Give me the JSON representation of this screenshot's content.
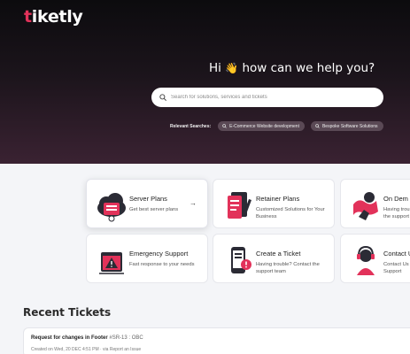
{
  "brand": {
    "logo_text_accent": "t",
    "logo_text_rest": "iketly",
    "accent_color": "#e2325a"
  },
  "hero": {
    "greeting_before": "Hi",
    "greeting_emoji": "👋",
    "greeting_after": "how can we help you?",
    "search_placeholder": "Search for solutions, services and tickets",
    "relevant_label": "Relevant Searches:",
    "relevant_chips": [
      "E-Commerce Website development",
      "Bespoke Software Solutions"
    ]
  },
  "services": [
    {
      "title": "Server Plans",
      "description": "Get best server plans",
      "icon": "server-cloud-icon",
      "active": true
    },
    {
      "title": "Retainer Plans",
      "description": "Customized Solutions for Your Business",
      "icon": "document-plan-icon"
    },
    {
      "title": "On Dem",
      "description": "Having troub the support",
      "icon": "on-demand-icon"
    },
    {
      "title": "Emergency Support",
      "description": "Fast response to your needs",
      "icon": "warning-window-icon"
    },
    {
      "title": "Create a Ticket",
      "description": "Having trouble? Contact the support team",
      "icon": "ticket-phone-icon"
    },
    {
      "title": "Contact U",
      "description": "Contact Us Support",
      "icon": "headset-agent-icon"
    }
  ],
  "recent": {
    "heading": "Recent Tickets",
    "tickets": [
      {
        "title": "Request for changes in Footer",
        "ref": "#SR-13 : OBC",
        "meta": "Created on Wed, 20 DEC 4:51 PM · via Report an Issue"
      }
    ]
  }
}
